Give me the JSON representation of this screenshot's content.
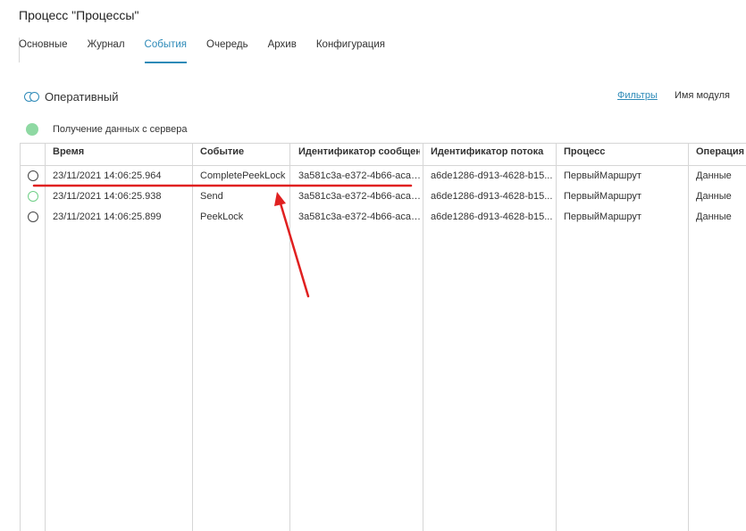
{
  "page": {
    "title": "Процесс \"Процессы\""
  },
  "tabs": [
    {
      "label": "Основные",
      "active": false
    },
    {
      "label": "Журнал",
      "active": false
    },
    {
      "label": "События",
      "active": true
    },
    {
      "label": "Очередь",
      "active": false
    },
    {
      "label": "Архив",
      "active": false
    },
    {
      "label": "Конфигурация",
      "active": false
    }
  ],
  "toolbar": {
    "mode_label": "Оперативный",
    "filters_label": "Фильтры",
    "module_label": "Имя модуля"
  },
  "status": {
    "text": "Получение данных с сервера",
    "color": "#8fd9a3"
  },
  "table": {
    "columns": [
      "Время",
      "Событие",
      "Идентификатор сообщения",
      "Идентификатор потока",
      "Процесс",
      "Операция"
    ],
    "rows": [
      {
        "radio_color": "#444444",
        "time": "23/11/2021 14:06:25.964",
        "event": "CompletePeekLock",
        "message_id": "3a581c3a-e372-4b66-acaa...",
        "flow_id": "a6de1286-d913-4628-b15...",
        "process": "ПервыйМаршрут",
        "operation": "Данные"
      },
      {
        "radio_color": "#6fcf87",
        "time": "23/11/2021 14:06:25.938",
        "event": "Send",
        "message_id": "3a581c3a-e372-4b66-acaa...",
        "flow_id": "a6de1286-d913-4628-b15...",
        "process": "ПервыйМаршрут",
        "operation": "Данные"
      },
      {
        "radio_color": "#444444",
        "time": "23/11/2021 14:06:25.899",
        "event": "PeekLock",
        "message_id": "3a581c3a-e372-4b66-acaa...",
        "flow_id": "a6de1286-d913-4628-b15...",
        "process": "ПервыйМаршрут",
        "operation": "Данные"
      }
    ]
  },
  "annotation": {
    "color": "#e02020"
  }
}
